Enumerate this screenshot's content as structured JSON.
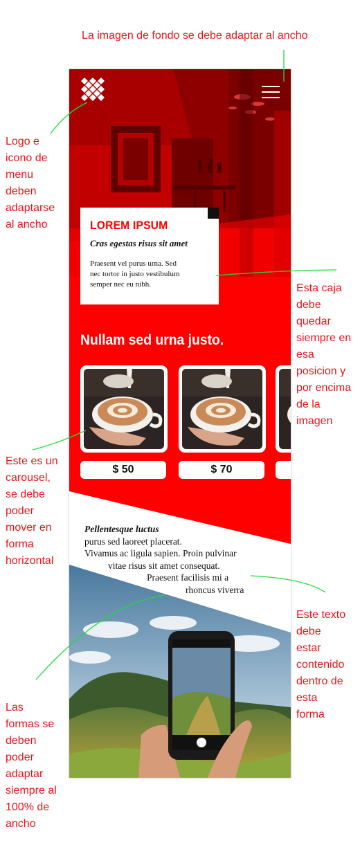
{
  "annotations": {
    "background": "La imagen de fondo se debe adaptar al ancho",
    "logo_menu": [
      "Logo e",
      "icono de",
      "menu",
      "deben",
      "adaptarse",
      "al ancho"
    ],
    "card_box": [
      "Esta caja",
      "debe",
      "quedar",
      "siempre en",
      "esa",
      "posicion y",
      "por encima",
      "de la",
      "imagen"
    ],
    "carousel": [
      "Este es un",
      "carousel,",
      "se debe",
      "poder",
      "mover en",
      "forma",
      "horizontal"
    ],
    "text_shape": [
      "Este texto",
      "debe",
      "estar",
      "contenido",
      "dentro de",
      "esta",
      "forma"
    ],
    "shapes": [
      "Las",
      "formas se",
      "deben",
      "poder",
      "adaptar",
      "siempre al",
      "100% de",
      "ancho"
    ]
  },
  "header": {
    "logo_icon": "diamond-grid-logo",
    "menu_icon": "hamburger-menu-icon"
  },
  "card": {
    "title": "LOREM IPSUM",
    "subtitle": "Cras egestas risus sit amet",
    "body_lines": [
      "Praesent vel purus urna. Sed",
      "nec tortor in justo vestibulum",
      "semper nec eu nibh."
    ]
  },
  "section": {
    "title": "Nullam sed urna justo."
  },
  "carousel": {
    "items": [
      {
        "image": "latte-art-coffee-cup",
        "price": "$ 50"
      },
      {
        "image": "latte-art-coffee-cup",
        "price": "$ 70"
      },
      {
        "image": "latte-art-coffee-cup",
        "price": ""
      }
    ]
  },
  "text_block": {
    "lines": [
      "Pellentesque luctus",
      "purus sed laoreet placerat.",
      "Vivamus ac ligula sapien. Proin pulvinar",
      "vitae risus sit amet consequat.",
      "Praesent facilisis mi a",
      "rhoncus viverra"
    ]
  },
  "colors": {
    "brand_red": "#ff0000",
    "annotation_red": "#e8151b",
    "leader_green": "#1fdc3a",
    "card_bg": "#ffffff"
  }
}
